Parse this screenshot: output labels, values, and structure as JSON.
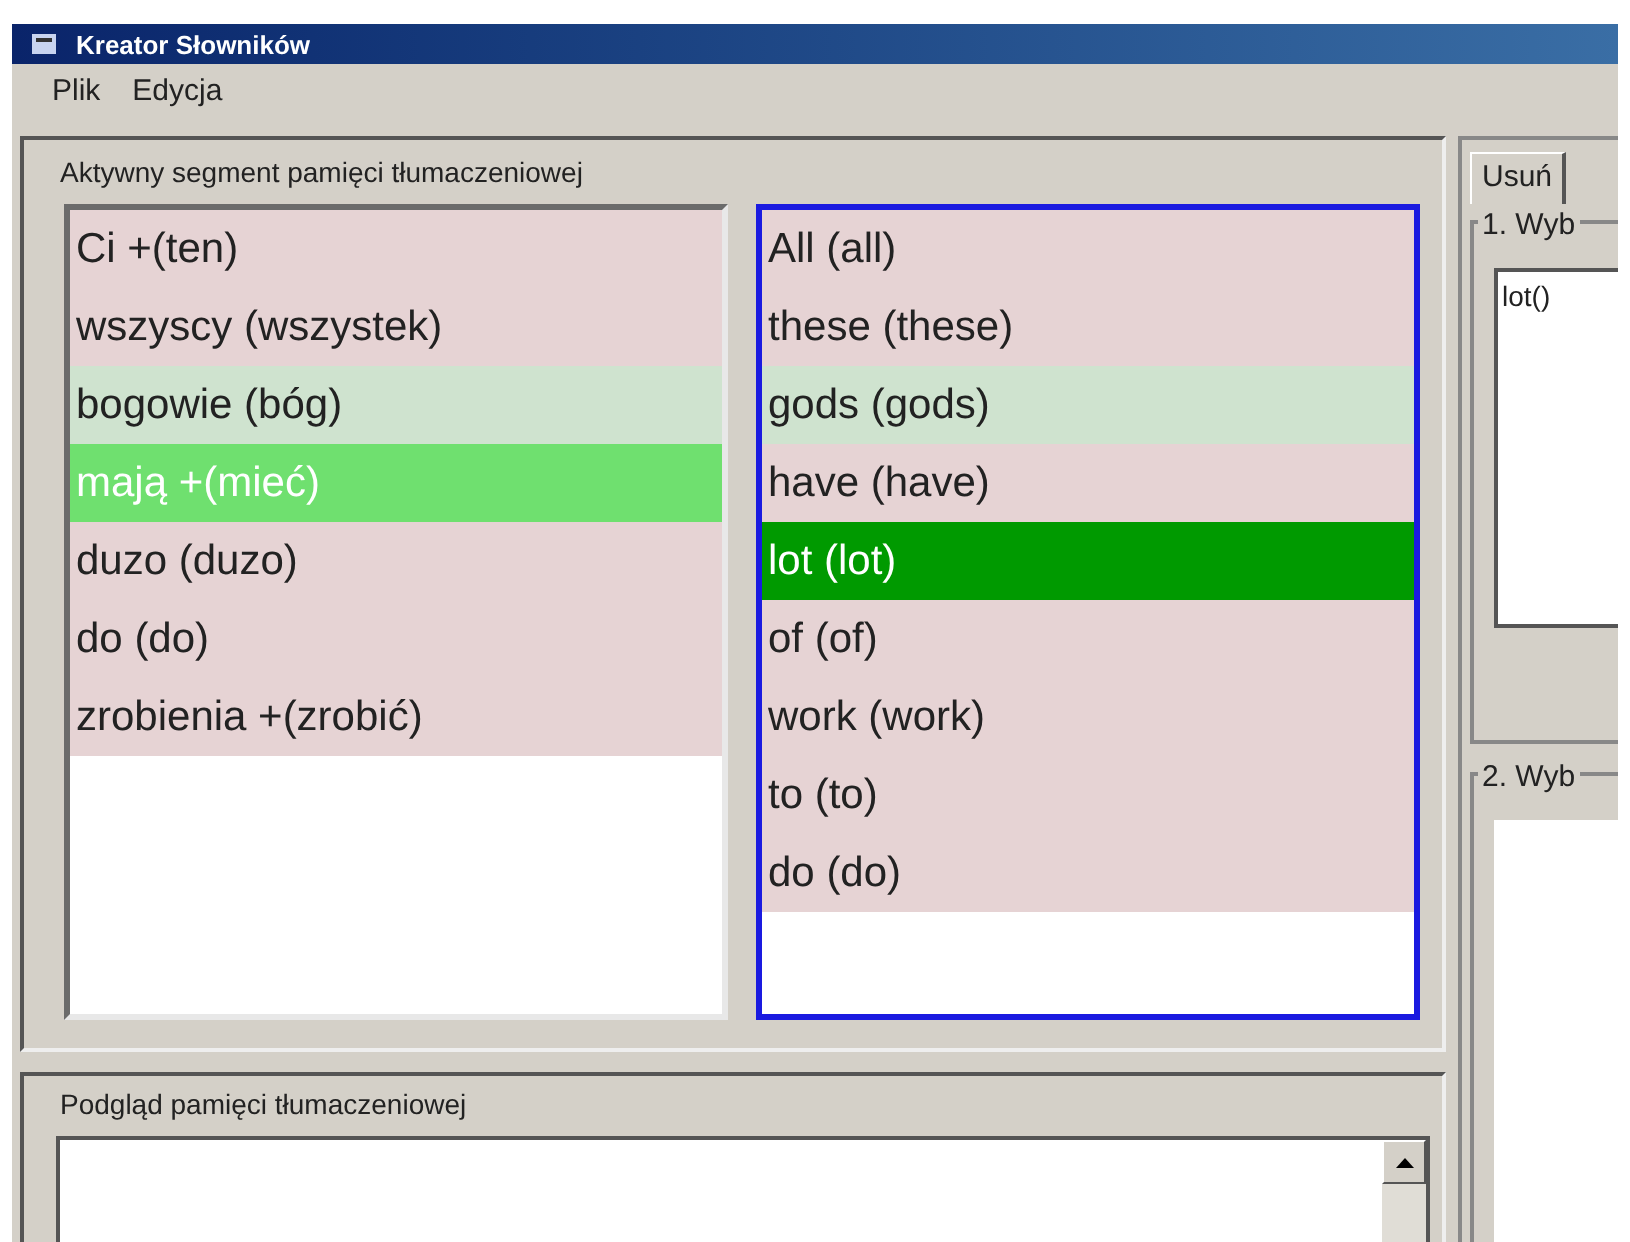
{
  "window": {
    "title": "Kreator Słowników"
  },
  "menu": [
    "Plik",
    "Edycja"
  ],
  "segment_group": {
    "title": "Aktywny segment pamięci tłumaczeniowej",
    "source": [
      {
        "text": "Ci +(ten)",
        "kind": "plain"
      },
      {
        "text": "wszyscy (wszystek)",
        "kind": "plain"
      },
      {
        "text": "bogowie (bóg)",
        "kind": "aligned"
      },
      {
        "text": "mają +(mieć)",
        "kind": "current"
      },
      {
        "text": "duzo (duzo)",
        "kind": "plain"
      },
      {
        "text": "do (do)",
        "kind": "plain"
      },
      {
        "text": "zrobienia +(zrobić)",
        "kind": "plain"
      }
    ],
    "target": [
      {
        "text": "All (all)",
        "kind": "plain"
      },
      {
        "text": "these (these)",
        "kind": "plain"
      },
      {
        "text": "gods (gods)",
        "kind": "aligned"
      },
      {
        "text": "have (have)",
        "kind": "plain"
      },
      {
        "text": "lot (lot)",
        "kind": "chosen"
      },
      {
        "text": "of (of)",
        "kind": "plain"
      },
      {
        "text": "work (work)",
        "kind": "plain"
      },
      {
        "text": "to (to)",
        "kind": "plain"
      },
      {
        "text": "do (do)",
        "kind": "plain"
      }
    ],
    "target_focused": true
  },
  "preview_group": {
    "title": "Podgląd pamięci tłumaczeniowej"
  },
  "side_panel": {
    "tabs": [
      {
        "label": "Usuń",
        "selected": true
      }
    ],
    "group_1": {
      "title": "1. Wyb",
      "items": [
        "lot()"
      ]
    },
    "group_2": {
      "title": "2. Wyb"
    }
  }
}
